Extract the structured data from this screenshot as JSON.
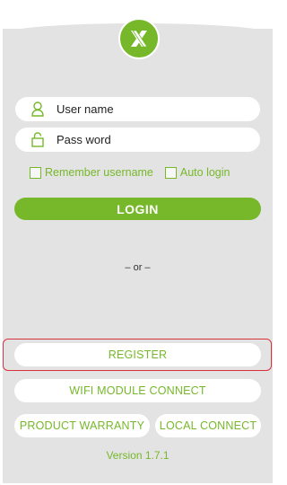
{
  "login_form": {
    "username_placeholder": "User name",
    "password_placeholder": "Pass word",
    "remember_label": "Remember username",
    "auto_login_label": "Auto login",
    "login_label": "LOGIN"
  },
  "divider": {
    "label": "– or –"
  },
  "actions": {
    "register_label": "REGISTER",
    "wifi_module_label": "WIFI MODULE CONNECT",
    "product_warranty_label": "PRODUCT WARRANTY",
    "local_connect_label": "LOCAL CONNECT"
  },
  "footer": {
    "version": "Version 1.7.1"
  },
  "icons": {
    "logo": "x-logo-icon",
    "user": "user-icon",
    "lock": "lock-icon"
  },
  "colors": {
    "accent": "#76b82a",
    "panel_background": "#e3e3e3",
    "highlight_border": "#d9323c"
  }
}
